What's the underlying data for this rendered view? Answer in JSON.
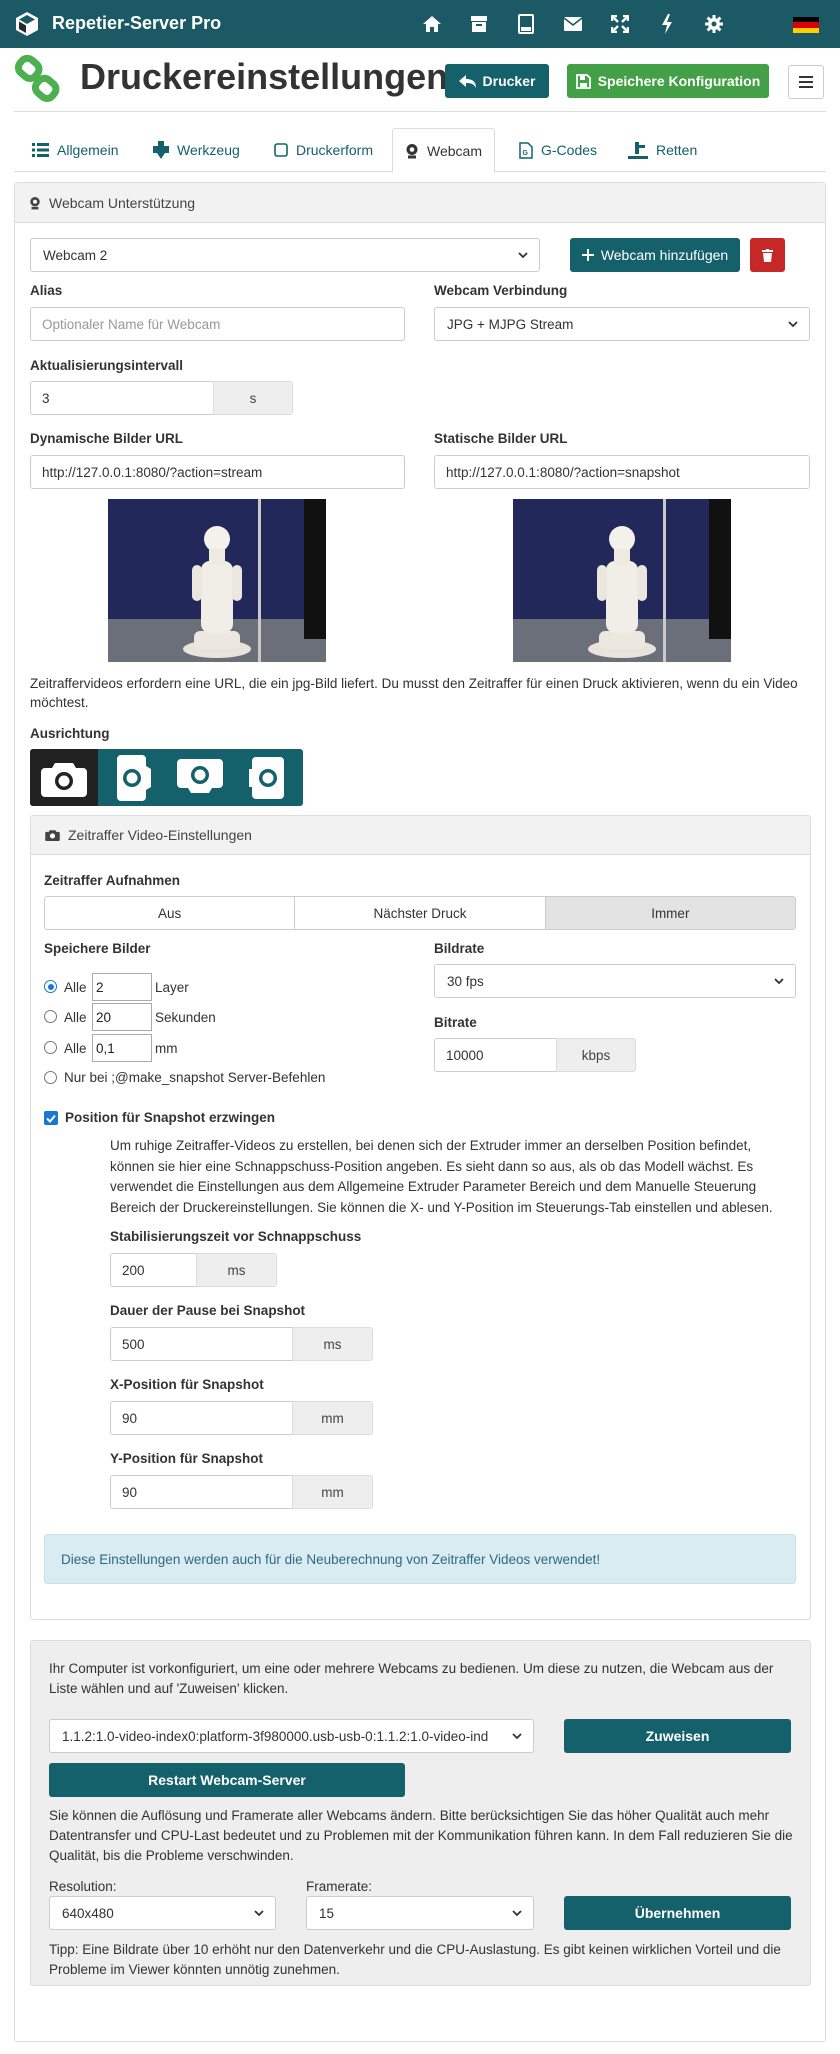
{
  "app": {
    "name": "Repetier-Server Pro"
  },
  "colors": {
    "topbar": "#1b5964",
    "accent": "#14606b",
    "green": "#43a047",
    "red": "#c62828",
    "info_bg": "#d9ecf2"
  },
  "header": {
    "title": "Druckereinstellungen",
    "back_label": "Drucker",
    "save_label": "Speichere Konfiguration"
  },
  "tabs": [
    {
      "label": "Allgemein",
      "icon": "list-icon"
    },
    {
      "label": "Werkzeug",
      "icon": "extruder-icon"
    },
    {
      "label": "Druckerform",
      "icon": "square-icon"
    },
    {
      "label": "Webcam",
      "icon": "webcam-icon",
      "active": true
    },
    {
      "label": "G-Codes",
      "icon": "gcode-file-icon"
    },
    {
      "label": "Retten",
      "icon": "rescue-icon"
    }
  ],
  "webcam_panel": {
    "heading": "Webcam Unterstützung",
    "selected_webcam": "Webcam 2",
    "add_webcam_label": "Webcam hinzufügen",
    "alias_label": "Alias",
    "alias_placeholder": "Optionaler Name für Webcam",
    "connection_label": "Webcam Verbindung",
    "connection_value": "JPG + MJPG Stream",
    "interval_label": "Aktualisierungsintervall",
    "interval_value": "3",
    "interval_unit": "s",
    "dynamic_url_label": "Dynamische Bilder URL",
    "dynamic_url_value": "http://127.0.0.1:8080/?action=stream",
    "static_url_label": "Statische Bilder URL",
    "static_url_value": "http://127.0.0.1:8080/?action=snapshot",
    "timelapse_note": "Zeitraffervideos erfordern eine URL, die ein jpg-Bild liefert. Du musst den Zeitraffer für einen Druck aktivieren, wenn du ein Video möchtest.",
    "orientation_label": "Ausrichtung",
    "orientation_selected_index": 0
  },
  "timelapse": {
    "heading": "Zeitraffer Video-Einstellungen",
    "record_label": "Zeitraffer Aufnahmen",
    "record_options": [
      "Aus",
      "Nächster Druck",
      "Immer"
    ],
    "record_selected": "Immer",
    "save_images_label": "Speichere Bilder",
    "options": [
      {
        "prefix": "Alle",
        "value": "2",
        "suffix": "Layer",
        "checked": true
      },
      {
        "prefix": "Alle",
        "value": "20",
        "suffix": "Sekunden",
        "checked": false
      },
      {
        "prefix": "Alle",
        "value": "0,1",
        "suffix": "mm",
        "checked": false
      },
      {
        "prefix": "Nur bei ;@make_snapshot Server-Befehlen",
        "checked": false
      }
    ],
    "framerate_label": "Bildrate",
    "framerate_value": "30 fps",
    "bitrate_label": "Bitrate",
    "bitrate_value": "10000",
    "bitrate_unit": "kbps",
    "force_position_label": "Position für Snapshot erzwingen",
    "force_position_checked": true,
    "force_position_help": "Um ruhige Zeitraffer-Videos zu erstellen, bei denen sich der Extruder immer an derselben Position befindet, können sie hier eine Schnappschuss-Position angeben. Es sieht dann so aus, als ob das Modell wächst. Es verwendet die Einstellungen aus dem Allgemeine Extruder Parameter Bereich und dem Manuelle Steuerung Bereich der Druckereinstellungen. Sie können die X- und Y-Position im Steuerungs-Tab einstellen und ablesen.",
    "stabilization_label": "Stabilisierungszeit vor Schnappschuss",
    "stabilization_value": "200",
    "stabilization_unit": "ms",
    "pause_label": "Dauer der Pause bei Snapshot",
    "pause_value": "500",
    "pause_unit": "ms",
    "x_label": "X-Position für Snapshot",
    "x_value": "90",
    "x_unit": "mm",
    "y_label": "Y-Position für Snapshot",
    "y_value": "90",
    "y_unit": "mm",
    "info": "Diese Einstellungen werden auch für die Neuberechnung von Zeitraffer Videos verwendet!"
  },
  "preconfig": {
    "intro": "Ihr Computer ist vorkonfiguriert, um eine oder mehrere Webcams zu bedienen. Um diese zu nutzen, die Webcam aus der Liste wählen und auf 'Zuweisen' klicken.",
    "device_value": "1.1.2:1.0-video-index0:platform-3f980000.usb-usb-0:1.1.2:1.0-video-ind",
    "assign_label": "Zuweisen",
    "restart_label": "Restart Webcam-Server",
    "quality_note": "Sie können die Auflösung und Framerate aller Webcams ändern. Bitte berücksichtigen Sie das höher Qualität auch mehr Datentransfer und CPU-Last bedeutet und zu Problemen mit der Kommunikation führen kann. In dem Fall reduzieren Sie die Qualität, bis die Probleme verschwinden.",
    "resolution_label": "Resolution:",
    "resolution_value": "640x480",
    "framerate_label": "Framerate:",
    "framerate_value": "15",
    "apply_label": "Übernehmen",
    "tip": "Tipp: Eine Bildrate über 10 erhöht nur den Datenverkehr und die CPU-Auslastung. Es gibt keinen wirklichen Vorteil und die Probleme im Viewer könnten unnötig zunehmen."
  }
}
